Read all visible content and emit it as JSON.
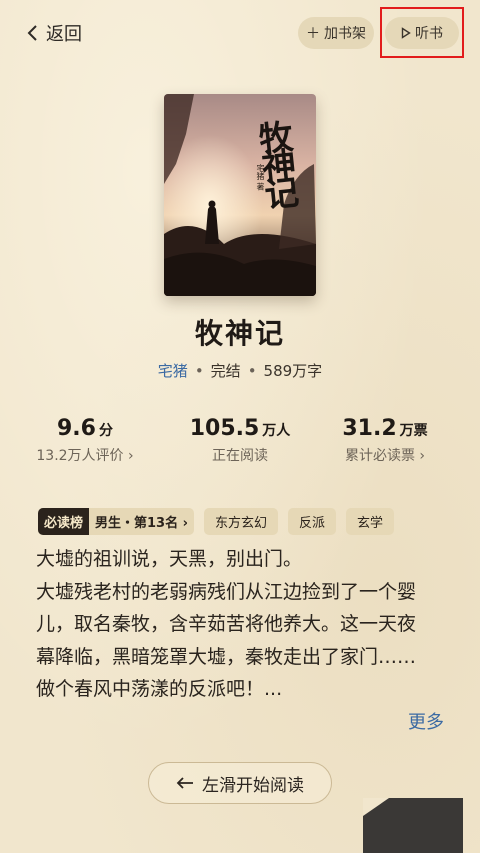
{
  "header": {
    "back_label": "返回",
    "shelf_label": "加书架",
    "listen_label": "听书"
  },
  "book": {
    "cover_title": "牧神记",
    "cover_author": "宅猪 著",
    "title": "牧神记",
    "author": "宅猪",
    "status": "完结",
    "word_count": "589万字"
  },
  "stats": [
    {
      "value": "9.6",
      "unit": "分",
      "label": "13.2万人评价",
      "has_arrow": true
    },
    {
      "value": "105.5",
      "unit": "万人",
      "label": "正在阅读",
      "has_arrow": false
    },
    {
      "value": "31.2",
      "unit": "万票",
      "label": "累计必读票",
      "has_arrow": true
    }
  ],
  "tags": {
    "rank_badge": "必读榜",
    "rank_text": "男生・第13名",
    "items": [
      "东方玄幻",
      "反派",
      "玄学"
    ]
  },
  "synopsis": {
    "lines": [
      "大墟的祖训说，天黑，别出门。",
      "大墟残老村的老弱病残们从江边捡到了一个婴",
      "儿，取名秦牧，含辛茹苦将他养大。这一天夜",
      "幕降临，黑暗笼罩大墟，秦牧走出了家门……",
      "做个春风中荡漾的反派吧！..."
    ],
    "more_label": "更多"
  },
  "read_button": {
    "label": "左滑开始阅读"
  },
  "colors": {
    "accent_blue": "#3b6aa3",
    "background": "#f1e6cd",
    "highlight_red": "#e21c1c"
  }
}
